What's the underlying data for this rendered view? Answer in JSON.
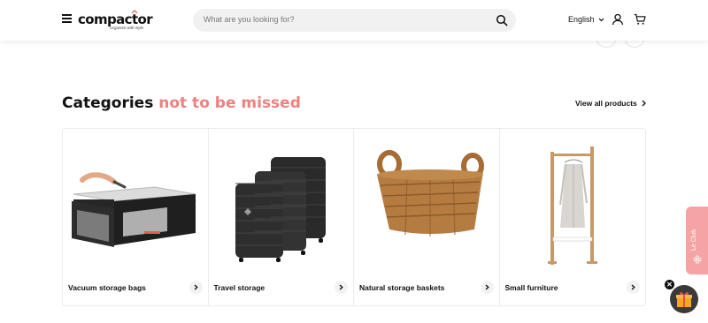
{
  "header": {
    "brand": "compactor",
    "tagline": "Organize with style",
    "search_placeholder": "What are you looking for?",
    "language": "English"
  },
  "section": {
    "title_part1": "Categories",
    "title_part2": "not to be missed",
    "view_all_label": "View all products"
  },
  "categories": [
    {
      "label": "Vacuum storage bags"
    },
    {
      "label": "Travel storage"
    },
    {
      "label": "Natural storage baskets"
    },
    {
      "label": "Small furniture"
    }
  ],
  "floating": {
    "club_label": "Le Club",
    "close_glyph": "✕"
  },
  "colors": {
    "accent": "#f08080",
    "club_tab": "#f4a4a4"
  },
  "icons": [
    "menu-icon",
    "search-icon",
    "chevron-down-icon",
    "user-icon",
    "cart-icon",
    "chevron-right-icon",
    "gift-icon",
    "close-icon"
  ]
}
